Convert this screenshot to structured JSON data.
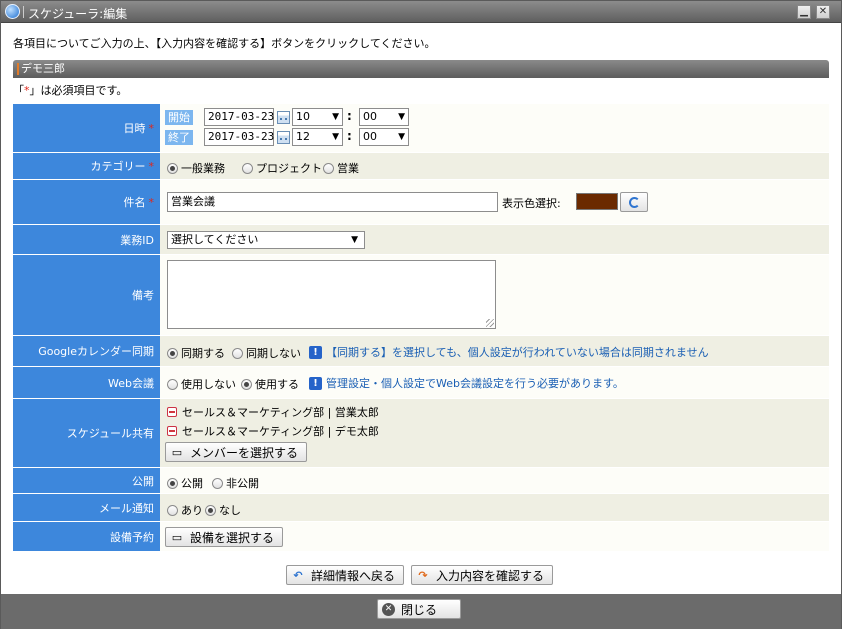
{
  "window": {
    "title": "スケジューラ:編集"
  },
  "instruction": "各項目についてご入力の上、【入力内容を確認する】ボタンをクリックしてください。",
  "section_title": "デモ三郎",
  "required_note": {
    "prefix": "「",
    "star": "*",
    "suffix": "」は必須項目です。"
  },
  "datetime": {
    "label": "日時",
    "star": "*",
    "start": {
      "tag": "開始",
      "date": "2017-03-23",
      "hour": "10",
      "minute": "00"
    },
    "end": {
      "tag": "終了",
      "date": "2017-03-23",
      "hour": "12",
      "minute": "00"
    },
    "colon": ":"
  },
  "category": {
    "label": "カテゴリー",
    "star": "*",
    "options": [
      {
        "label": "一般業務",
        "checked": true
      },
      {
        "label": "プロジェクト",
        "checked": false
      },
      {
        "label": "営業",
        "checked": false
      }
    ]
  },
  "subject": {
    "label": "件名",
    "star": "*",
    "value": "営業会議",
    "color_label": "表示色選択:",
    "color": "#6b2a00"
  },
  "business_id": {
    "label": "業務ID",
    "value": "選択してください"
  },
  "note": {
    "label": "備考",
    "value": ""
  },
  "google_sync": {
    "label": "Googleカレンダー同期",
    "options": [
      {
        "label": "同期する",
        "checked": true
      },
      {
        "label": "同期しない",
        "checked": false
      }
    ],
    "info": "【同期する】を選択しても、個人設定が行われていない場合は同期されません"
  },
  "web_meeting": {
    "label": "Web会議",
    "options": [
      {
        "label": "使用しない",
        "checked": false
      },
      {
        "label": "使用する",
        "checked": true
      }
    ],
    "info": "管理設定・個人設定でWeb会議設定を行う必要があります。"
  },
  "share": {
    "label": "スケジュール共有",
    "members": [
      "セールス＆マーケティング部 | 営業太郎",
      "セールス＆マーケティング部 | デモ太郎"
    ],
    "button": "メンバーを選択する"
  },
  "public": {
    "label": "公開",
    "options": [
      {
        "label": "公開",
        "checked": true
      },
      {
        "label": "非公開",
        "checked": false
      }
    ]
  },
  "mail": {
    "label": "メール通知",
    "options": [
      {
        "label": "あり",
        "checked": false
      },
      {
        "label": "なし",
        "checked": true
      }
    ]
  },
  "facility": {
    "label": "設備予約",
    "button": "設備を選択する"
  },
  "actions": {
    "back": "詳細情報へ戻る",
    "confirm": "入力内容を確認する",
    "close": "閉じる"
  },
  "colors": {
    "label_bg": "#3d87dc",
    "accent": "#1a5fb4"
  }
}
